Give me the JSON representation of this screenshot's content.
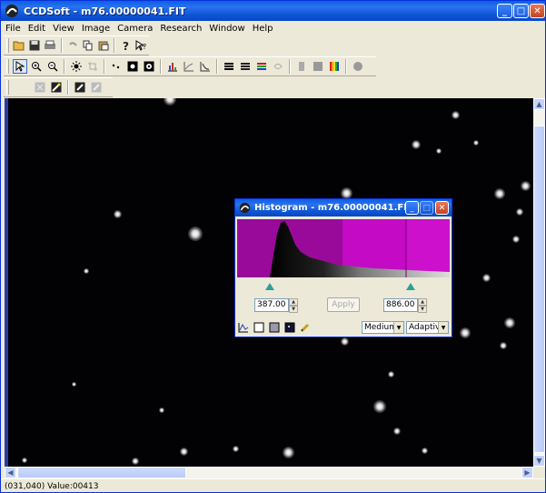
{
  "window": {
    "title": "CCDSoft  - m76.00000041.FIT",
    "controls": {
      "minimize": "_",
      "maximize": "□",
      "close": "✕"
    }
  },
  "menu": [
    "File",
    "Edit",
    "View",
    "Image",
    "Camera",
    "Research",
    "Window",
    "Help"
  ],
  "toolbar1": {
    "icons": [
      "open-icon",
      "save-icon",
      "print-icon",
      "undo-icon",
      "copy-icon",
      "paste-icon",
      "help-icon",
      "context-help-icon"
    ]
  },
  "toolbar2": {
    "icons": [
      "pointer-icon",
      "zoom-in-icon",
      "zoom-out-icon",
      "brightness-icon",
      "crop-icon",
      "star-icon",
      "invert-icon",
      "contrast-icon",
      "histogram-icon",
      "graph-icon",
      "chart-icon",
      "stack-icon",
      "layers-icon",
      "color-stack-icon",
      "color-icon",
      "gray-block-icon",
      "gray-block-icon",
      "spectrum-icon",
      "circle-icon"
    ]
  },
  "toolbar3": {
    "icons": [
      "close-x-icon",
      "wand-icon",
      "image-edit-icon",
      "image-filter-icon"
    ]
  },
  "status": {
    "text": "(031,040) Value:00413"
  },
  "histogram": {
    "title": "Histogram - m76.00000041.FIT",
    "low_value": "387.00",
    "high_value": "886.00",
    "apply_label": "Apply",
    "quality_select": "Medium",
    "mode_select": "Adaptive",
    "colors": {
      "background": "#cc10cc",
      "left_band": "#990099",
      "right_band": "#bb00bb",
      "marker": "#2aa198"
    }
  }
}
